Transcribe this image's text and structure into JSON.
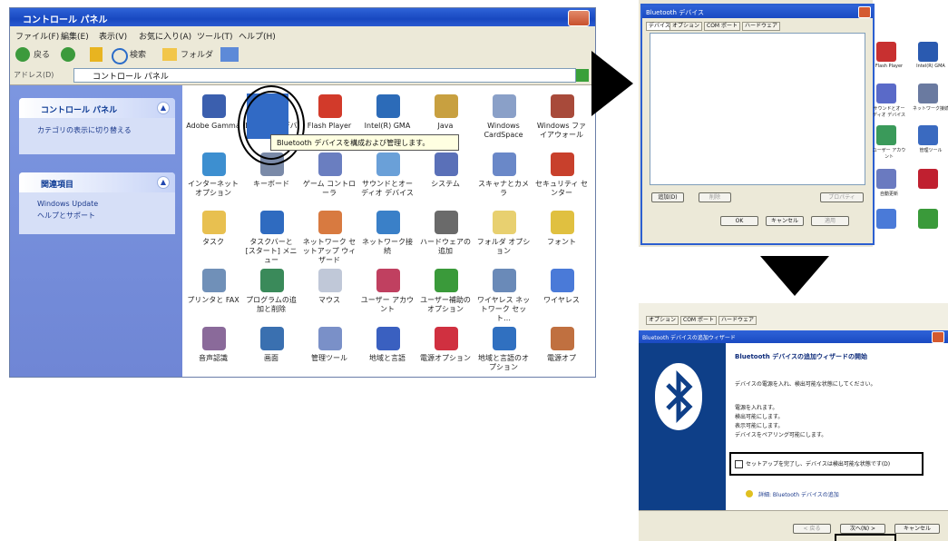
{
  "cp": {
    "title": "コントロール パネル",
    "menu": [
      "ファイル(F)",
      "編集(E)",
      "表示(V)",
      "お気に入り(A)",
      "ツール(T)",
      "ヘルプ(H)"
    ],
    "toolbar": {
      "back": "戻る",
      "search": "検索",
      "folders": "フォルダ"
    },
    "address_label": "アドレス(D)",
    "address_value": "コントロール パネル",
    "sidebar": {
      "panel1_title": "コントロール パネル",
      "panel1_link": "カテゴリの表示に切り替える",
      "panel2_title": "関連項目",
      "panel2_links": [
        "Windows Update",
        "ヘルプとサポート"
      ]
    },
    "icons": [
      "Adobe Gamma",
      "Bluetooth デバイス",
      "Flash Player",
      "Intel(R) GMA",
      "Java",
      "Windows CardSpace",
      "Windows ファイアウォール",
      "インターネット オプション",
      "キーボード",
      "ゲーム コントローラ",
      "サウンドとオーディオ デバイス",
      "システム",
      "スキャナとカメラ",
      "セキュリティ センター",
      "タスク",
      "タスクバーと [スタート] メニュー",
      "ネットワーク セットアップ ウィザード",
      "ネットワーク接続",
      "ハードウェアの追加",
      "フォルダ オプション",
      "フォント",
      "プリンタと FAX",
      "プログラムの追加と削除",
      "マウス",
      "ユーザー アカウント",
      "ユーザー補助のオプション",
      "ワイヤレス ネットワーク セット…",
      "ワイヤレス",
      "音声認識",
      "画面",
      "管理ツール",
      "地域と言語",
      "電源オプション",
      "地域と言語のオプション",
      "電源オプ"
    ],
    "tooltip": "Bluetooth デバイスを構成および管理します。"
  },
  "btd": {
    "title": "Bluetooth デバイス",
    "tabs": [
      "デバイス",
      "オプション",
      "COM ポート",
      "ハードウェア"
    ],
    "buttons": {
      "add": "追加(D)",
      "remove": "削除",
      "properties": "プロパティ",
      "ok": "OK",
      "cancel": "キャンセル",
      "apply": "適用"
    },
    "right_icons": [
      "Flash Player",
      "Intel(R) GMA",
      "サウンドとオーディオ デバイス",
      "ネットワーク接続",
      "ユーザー アカウント",
      "管理ツール",
      "自動更新"
    ]
  },
  "wz": {
    "tabs": [
      "オプション",
      "COM ポート",
      "ハードウェア"
    ],
    "title": "Bluetooth デバイスの追加ウィザード",
    "heading": "Bluetooth デバイスの追加ウィザードの開始",
    "body": "デバイスの電源を入れ、検出可能な状態にしてください。",
    "bullets": [
      "電源を入れます。",
      "検出可能にします。",
      "表示可能にします。",
      "デバイスをペアリング可能にします。"
    ],
    "checkbox": "セットアップを完了し、デバイスは検出可能な状態です(D)",
    "help_link": "詳細: Bluetooth デバイスの追加",
    "buttons": {
      "back": "< 戻る",
      "next": "次へ(N) >",
      "cancel": "キャンセル"
    }
  }
}
